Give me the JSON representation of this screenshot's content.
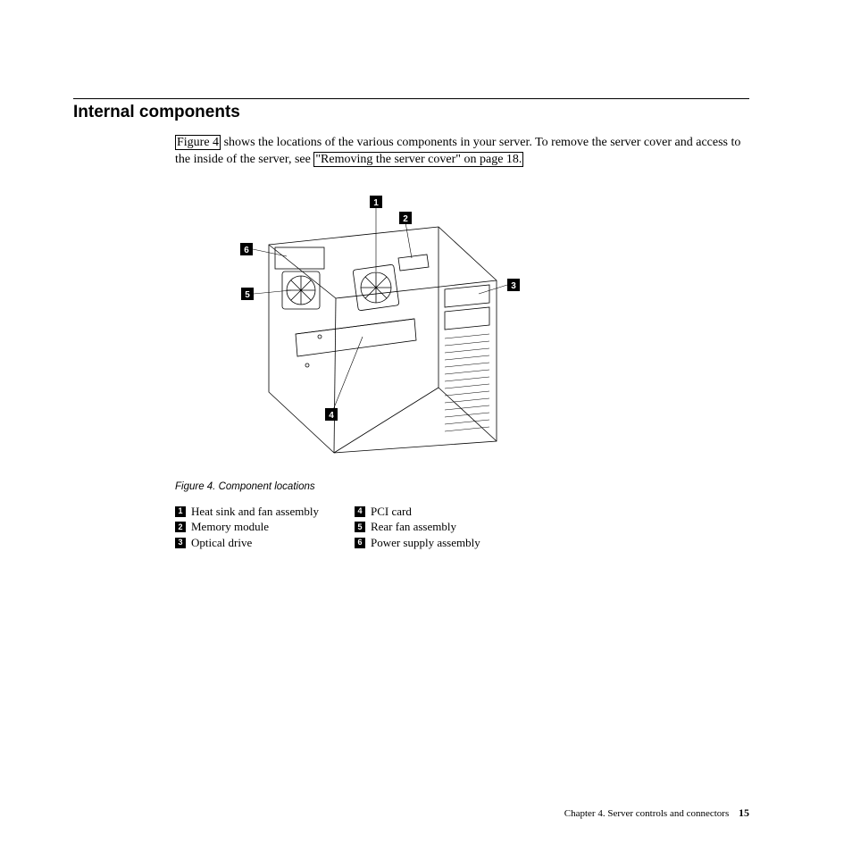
{
  "heading": "Internal components",
  "body": {
    "link_figure": "Figure 4",
    "text1": " shows the locations of the various components in your server. To remove the server cover and access to the inside of the server, see ",
    "link_ref": "\"Removing the server cover\" on page 18."
  },
  "figure": {
    "caption": "Figure 4. Component locations",
    "callouts": {
      "c1": "1",
      "c2": "2",
      "c3": "3",
      "c4": "4",
      "c5": "5",
      "c6": "6"
    }
  },
  "legend": {
    "left": [
      {
        "num": "1",
        "label": "Heat sink and fan assembly"
      },
      {
        "num": "2",
        "label": "Memory module"
      },
      {
        "num": "3",
        "label": "Optical drive"
      }
    ],
    "right": [
      {
        "num": "4",
        "label": "PCI card"
      },
      {
        "num": "5",
        "label": "Rear fan assembly"
      },
      {
        "num": "6",
        "label": "Power supply assembly"
      }
    ]
  },
  "footer": {
    "chapter": "Chapter 4. Server controls and connectors",
    "page": "15"
  }
}
